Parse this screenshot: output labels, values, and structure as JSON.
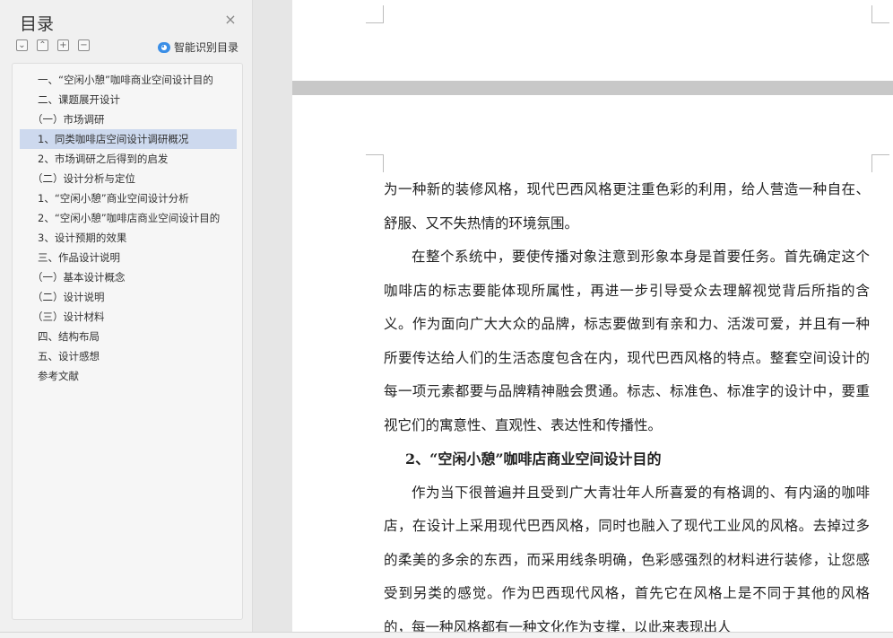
{
  "sidebar": {
    "title": "目录",
    "close_icon": "×",
    "tools": {
      "collapse_all": "⌄",
      "expand_up": "⌃",
      "add": "+",
      "remove": "−"
    },
    "smart_label": "智能识别目录",
    "items": [
      {
        "label": "一、“空闲小憩”咖啡商业空间设计目的",
        "indent": 20
      },
      {
        "label": "二、课题展开设计",
        "indent": 20
      },
      {
        "label": "（一）市场调研",
        "indent": 14
      },
      {
        "label": "1、同类咖啡店空间设计调研概况",
        "indent": 20,
        "selected": true
      },
      {
        "label": "2、市场调研之后得到的启发",
        "indent": 20
      },
      {
        "label": "（二）设计分析与定位",
        "indent": 14
      },
      {
        "label": "1、“空闲小憩”商业空间设计分析",
        "indent": 20
      },
      {
        "label": "2、“空闲小憩”咖啡店商业空间设计目的",
        "indent": 20
      },
      {
        "label": "3、设计预期的效果",
        "indent": 20
      },
      {
        "label": "三、作品设计说明",
        "indent": 20
      },
      {
        "label": "（一）基本设计概念",
        "indent": 14
      },
      {
        "label": "（二）设计说明",
        "indent": 14
      },
      {
        "label": "（三）设计材料",
        "indent": 14
      },
      {
        "label": "四、结构布局",
        "indent": 20
      },
      {
        "label": "五、设计感想",
        "indent": 20
      },
      {
        "label": "参考文献",
        "indent": 20
      }
    ]
  },
  "document": {
    "paragraphs": [
      {
        "type": "para",
        "indent": false,
        "text": "为一种新的装修风格，现代巴西风格更注重色彩的利用，给人营造一种自在、舒服、又不失热情的环境氛围。"
      },
      {
        "type": "para",
        "indent": true,
        "text": "在整个系统中，要使传播对象注意到形象本身是首要任务。首先确定这个咖啡店的标志要能体现所属性，再进一步引导受众去理解视觉背后所指的含义。作为面向广大大众的品牌，标志要做到有亲和力、活泼可爱，并且有一种所要传达给人们的生活态度包含在内，现代巴西风格的特点。整套空间设计的每一项元素都要与品牌精神融会贯通。标志、标准色、标准字的设计中，要重视它们的寓意性、直观性、表达性和传播性。"
      },
      {
        "type": "heading",
        "text": "2、“空闲小憩”咖啡店商业空间设计目的"
      },
      {
        "type": "para",
        "indent": true,
        "text": "作为当下很普遍并且受到广大青壮年人所喜爱的有格调的、有内涵的咖啡店，在设计上采用现代巴西风格，同时也融入了现代工业风的风格。去掉过多的柔美的多余的东西，而采用线条明确，色彩感强烈的材料进行装修，让您感受到另类的感觉。作为巴西现代风格，首先它在风格上是不同于其他的风格的，每一种风格都有一种文化作为支撑，以此来表现出人"
      }
    ]
  },
  "colors": {
    "selected_row": "#cdd9ee",
    "page_bg": "#ffffff",
    "workspace_bg": "#e6e6e6",
    "smart_icon": "#3a8ee6"
  }
}
